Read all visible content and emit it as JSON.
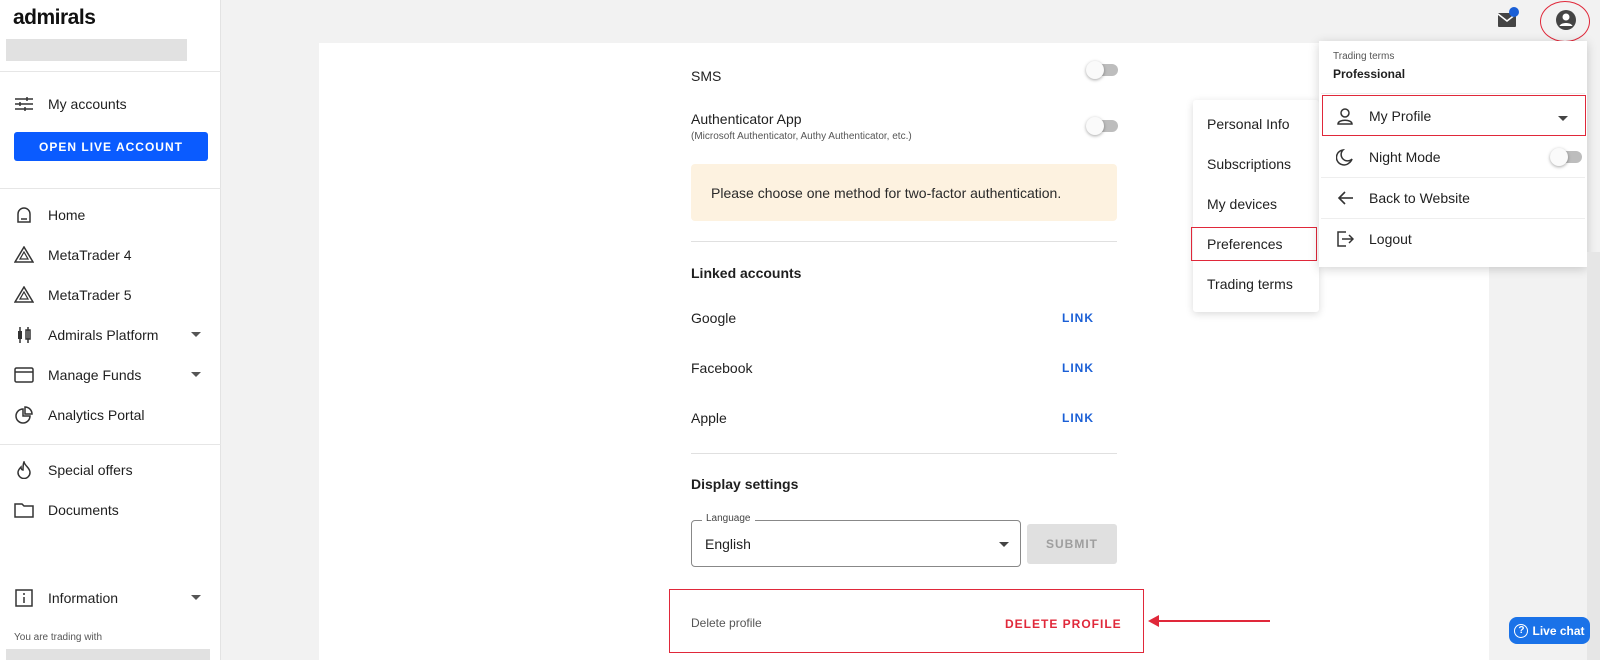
{
  "sidebar": {
    "logo": "admirals",
    "my_accounts": "My accounts",
    "open_live_account": "OPEN LIVE ACCOUNT",
    "items": [
      {
        "label": "Home"
      },
      {
        "label": "MetaTrader 4"
      },
      {
        "label": "MetaTrader 5"
      },
      {
        "label": "Admirals Platform"
      },
      {
        "label": "Manage Funds"
      },
      {
        "label": "Analytics Portal"
      },
      {
        "label": "Special offers"
      },
      {
        "label": "Documents"
      },
      {
        "label": "Information"
      }
    ],
    "trading_with": "You are trading with"
  },
  "security": {
    "sms_label": "SMS",
    "auth_app_label": "Authenticator App",
    "auth_app_sub": "(Microsoft Authenticator, Authy Authenticator, etc.)",
    "notice": "Please choose one method for two-factor authentication."
  },
  "linked": {
    "title": "Linked accounts",
    "providers": [
      {
        "name": "Google",
        "action": "LINK"
      },
      {
        "name": "Facebook",
        "action": "LINK"
      },
      {
        "name": "Apple",
        "action": "LINK"
      }
    ]
  },
  "display": {
    "title": "Display settings",
    "language_label": "Language",
    "language_value": "English",
    "submit": "SUBMIT"
  },
  "delete": {
    "label": "Delete profile",
    "button": "DELETE PROFILE"
  },
  "submenu": {
    "items": [
      "Personal Info",
      "Subscriptions",
      "My devices",
      "Preferences",
      "Trading terms"
    ]
  },
  "profile_menu": {
    "trading_terms_label": "Trading terms",
    "trading_terms_value": "Professional",
    "my_profile": "My Profile",
    "night_mode": "Night Mode",
    "back_to_website": "Back to Website",
    "logout": "Logout"
  },
  "live_chat": "Live chat",
  "colors": {
    "accent_blue": "#0a5bff",
    "link_blue": "#1a5fd6",
    "annotation_red": "#e0283a",
    "notice_bg": "#fdf2e0"
  }
}
